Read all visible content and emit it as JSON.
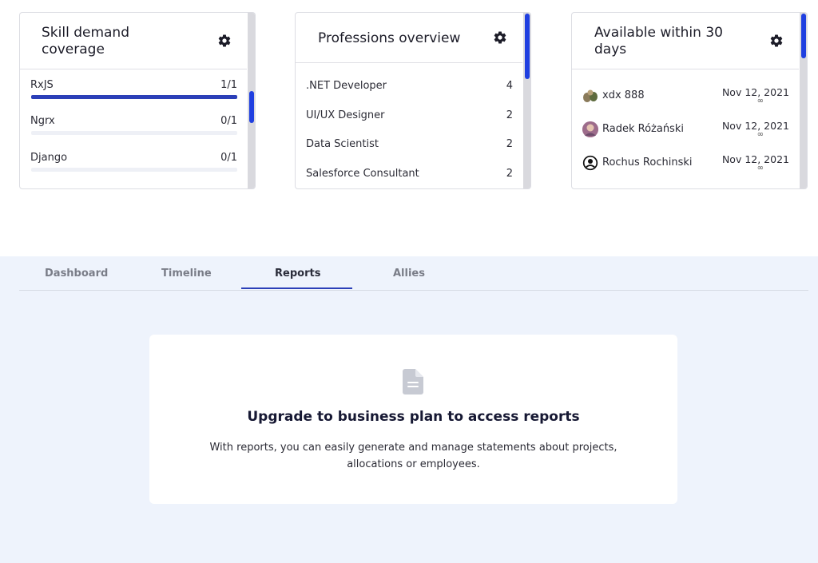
{
  "cards": {
    "skill": {
      "title_line1": "Skill demand",
      "title_line2": "coverage",
      "gear_icon": "gear-icon",
      "rows": [
        {
          "label": "RxJS",
          "value": "1/1",
          "fill": 1.0
        },
        {
          "label": "Ngrx",
          "value": "0/1",
          "fill": 0.0
        },
        {
          "label": "Django",
          "value": "0/1",
          "fill": 0.0
        }
      ]
    },
    "professions": {
      "title": "Professions overview",
      "gear_icon": "gear-icon",
      "rows": [
        {
          "label": ".NET Developer",
          "value": "4"
        },
        {
          "label": "UI/UX Designer",
          "value": "2"
        },
        {
          "label": "Data Scientist",
          "value": "2"
        },
        {
          "label": "Salesforce Consultant",
          "value": "2"
        }
      ]
    },
    "available": {
      "title_line1": "Available within 30",
      "title_line2": "days",
      "gear_icon": "gear-icon",
      "rows": [
        {
          "name": "xdx 888",
          "date": "Nov 12, 2021",
          "end": "∞"
        },
        {
          "name": "Radek Różański",
          "date": "Nov 12, 2021",
          "end": "∞"
        },
        {
          "name": "Rochus Rochinski",
          "date": "Nov 12, 2021",
          "end": "∞"
        }
      ]
    }
  },
  "tabs": [
    {
      "label": "Dashboard",
      "active": false
    },
    {
      "label": "Timeline",
      "active": false
    },
    {
      "label": "Reports",
      "active": true
    },
    {
      "label": "Allies",
      "active": false
    }
  ],
  "upgrade": {
    "icon": "document-icon",
    "title": "Upgrade to business plan to access reports",
    "text": "With reports, you can easily generate and manage statements about projects, allocations or employees."
  },
  "colors": {
    "accent": "#2b3fb8",
    "scrollbar": "#1f3fe0",
    "background_bottom": "#eef3fc"
  }
}
